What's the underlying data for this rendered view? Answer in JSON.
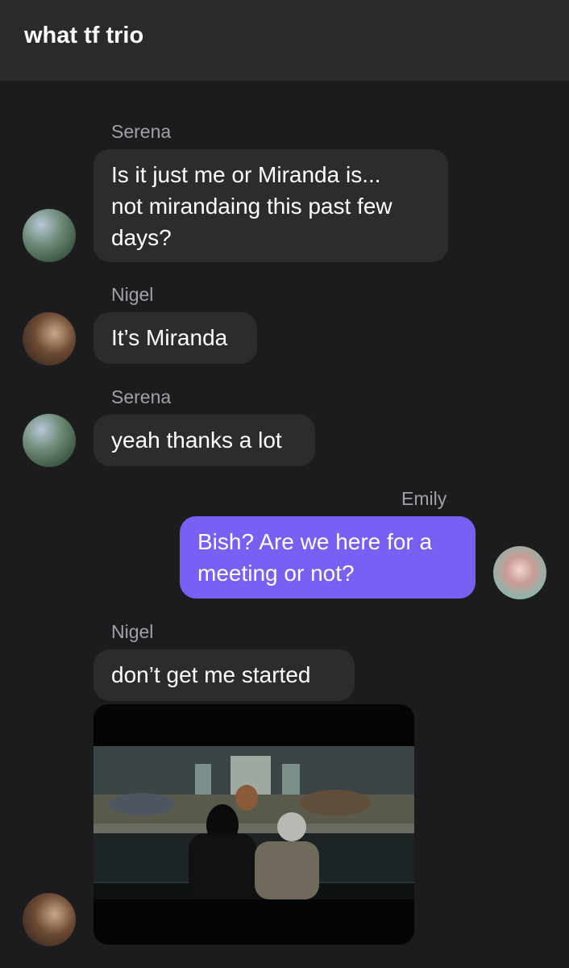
{
  "header": {
    "title": "what tf trio"
  },
  "messages": [
    {
      "sender": "Serena",
      "text": "Is it just me or Miranda is...\nnot mirandaing this past few\ndays?"
    },
    {
      "sender": "Nigel",
      "text": "It’s Miranda"
    },
    {
      "sender": "Serena",
      "text": "yeah thanks a lot"
    },
    {
      "sender": "Emily",
      "text": "Bish? Are we here for a\nmeeting or not?"
    },
    {
      "sender": "Nigel",
      "text": "don’t get me started"
    }
  ],
  "colors": {
    "background": "#1c1c1e",
    "header": "#2a2a2c",
    "incoming_bubble": "#2c2c2e",
    "outgoing_bubble": "#7760f3",
    "sender_name": "#a1a1a6"
  },
  "attachment": {
    "type": "image",
    "subject": "painting-scene-photo"
  }
}
